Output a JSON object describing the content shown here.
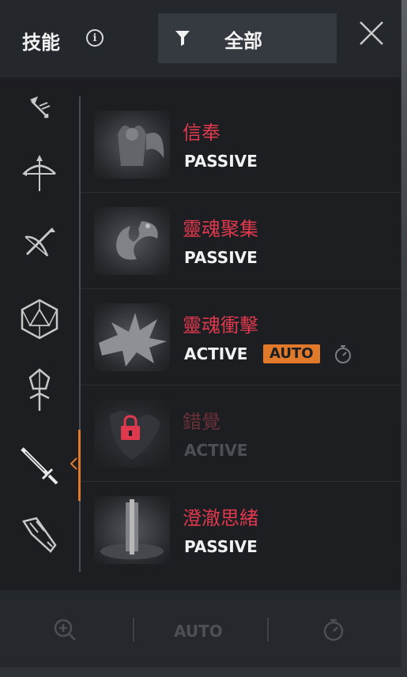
{
  "header": {
    "title": "技能",
    "info_icon": "info-icon",
    "filter_icon": "filter-icon",
    "filter_label": "全部",
    "close_icon": "close-icon"
  },
  "sidebar": {
    "categories": [
      {
        "icon": "winged-arrow-icon"
      },
      {
        "icon": "bow-icon"
      },
      {
        "icon": "crossbow-icon"
      },
      {
        "icon": "polyhedron-icon"
      },
      {
        "icon": "crystal-staff-icon"
      },
      {
        "icon": "sword-icon",
        "selected": true
      },
      {
        "icon": "gauntlet-icon"
      }
    ]
  },
  "skills": [
    {
      "name": "信奉",
      "type": "PASSIVE",
      "icon": "winged-figure-icon"
    },
    {
      "name": "靈魂聚集",
      "type": "PASSIVE",
      "icon": "dragon-icon"
    },
    {
      "name": "靈魂衝擊",
      "type": "ACTIVE",
      "auto": "AUTO",
      "icon": "explosion-icon",
      "timer_icon": "stopwatch-icon"
    },
    {
      "name": "錯覺",
      "type": "ACTIVE",
      "locked": true,
      "icon": "illusion-icon",
      "lock_icon": "lock-icon"
    },
    {
      "name": "澄澈思緒",
      "type": "PASSIVE",
      "icon": "light-pillar-icon"
    }
  ],
  "footer": {
    "zoom_icon": "zoom-in-icon",
    "auto_label": "AUTO",
    "stopwatch_icon": "stopwatch-icon"
  },
  "colors": {
    "skill_name": "#e0394e",
    "accent": "#e07a2a",
    "panel_bg": "#1c1e22"
  }
}
